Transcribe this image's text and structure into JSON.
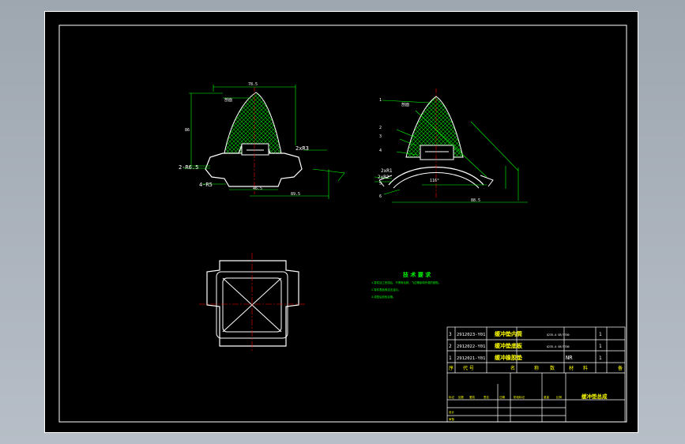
{
  "colors": {
    "background": "#000000",
    "frame": "#ffffff",
    "outline": "#ffffff",
    "dimension": "#00ff00",
    "hatch": "#00dd00",
    "center": "#ff0000",
    "title": "#ffff00",
    "bezel": "#b0b7c0"
  },
  "drawing": {
    "left_view": {
      "dims": {
        "top_width": "78.5",
        "height": "86",
        "r_small": "2-R6.5",
        "r_bottom": "4-R5",
        "r_right": "2xR3",
        "base_width": "46.5",
        "overall": "89.5"
      },
      "hatch_label": "剖面"
    },
    "right_view": {
      "labels": [
        "1",
        "2",
        "3",
        "4",
        "5",
        "6"
      ],
      "dims": {
        "r1": "2xR1",
        "r2": "2xR2",
        "width": "88.5",
        "angle": "116°"
      },
      "hatch_label": "剖面"
    },
    "tech": {
      "heading": "技 术 要 求",
      "notes": [
        "1.零件加工完成后，不得有毛刺、飞边等影响外观的缺陷。",
        "2.零件表面清洁无油污。",
        "3.成型后检验合格。"
      ]
    }
  },
  "title_block": {
    "rows": [
      {
        "no": "3",
        "code": "2912023-Y01",
        "name": "缓冲垫内筒",
        "material": "Q235-A GB/T700",
        "qty": "1"
      },
      {
        "no": "2",
        "code": "2912022-Y01",
        "name": "缓冲垫底板",
        "material": "Q235-A GB/T700",
        "qty": "1"
      },
      {
        "no": "1",
        "code": "2912021-Y01",
        "name": "缓冲橡胶垫",
        "material": "NR",
        "qty": "1"
      }
    ],
    "header": [
      "序",
      "代 号",
      "名",
      "称",
      "数",
      "材",
      "料",
      "备"
    ],
    "part_name": "缓冲垫总成",
    "small_fields": [
      "标记",
      "处数",
      "更改",
      "签名",
      "日期",
      "阶段标记",
      "重量",
      "比例",
      "设计",
      "审核"
    ]
  }
}
